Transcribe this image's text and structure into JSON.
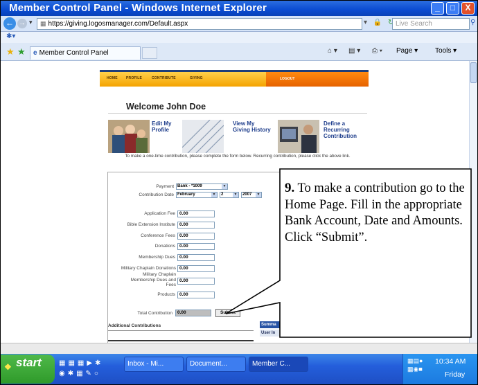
{
  "window": {
    "title": "Member Control Panel - Windows Internet Explorer",
    "minimize": "_",
    "maximize": "□",
    "close": "X"
  },
  "addressbar": {
    "url": "https://giving.logosmanager.com/Default.aspx",
    "search_placeholder": "Live Search",
    "lock_icon": "🔒",
    "refresh_icon": "↻",
    "stop_icon": "X"
  },
  "tabbar": {
    "tab_title": "Member Control Panel",
    "page_menu": "Page ▾",
    "tools_menu": "Tools ▾"
  },
  "site": {
    "nav": [
      "HOME",
      "PROFILE",
      "CONTRIBUTE",
      "GIVING"
    ],
    "logout": "LOGOUT",
    "welcome": "Welcome John Doe",
    "features": [
      {
        "label": "Edit My\nProfile"
      },
      {
        "label": "View My\nGiving History"
      },
      {
        "label": "Define a\nRecurring\nContribution"
      }
    ],
    "instructions": "To make a one-time contribution, please complete the form below. Recurring contribution, please click the above link.",
    "form": {
      "payment_label": "Payment",
      "payment_value": "Bank - *1009",
      "date_label": "Contribution Date",
      "date_month": "February",
      "date_day": "2",
      "date_year": "2007",
      "fields": [
        {
          "label": "Application Fee",
          "value": "0.00"
        },
        {
          "label": "Bible Extension Institute",
          "value": "0.00"
        },
        {
          "label": "Conference Fees",
          "value": "0.00"
        },
        {
          "label": "Donations",
          "value": "0.00"
        },
        {
          "label": "Membership Dues",
          "value": "0.00"
        },
        {
          "label": "Military Chaplain Donations",
          "value": "0.00"
        },
        {
          "label": "Military Chaplain Membership Dues and Fees",
          "value": "0.00"
        },
        {
          "label": "Products",
          "value": "0.00"
        }
      ],
      "total_label": "Total Contribution",
      "total_value": "0.00",
      "submit": "Submit"
    },
    "additional": "Additional Contributions",
    "summary_tab": "Summa",
    "userinfo_tab": "User In"
  },
  "callout": {
    "number": "9.",
    "text": " To make a contribution go to the Home Page.  Fill in the appropriate Bank Account, Date and Amounts.  Click “Submit”."
  },
  "taskbar": {
    "start": "start",
    "buttons": [
      "Inbox - Mi...",
      "Document...",
      "Member C..."
    ],
    "clock": "10:34 AM",
    "day": "Friday"
  }
}
